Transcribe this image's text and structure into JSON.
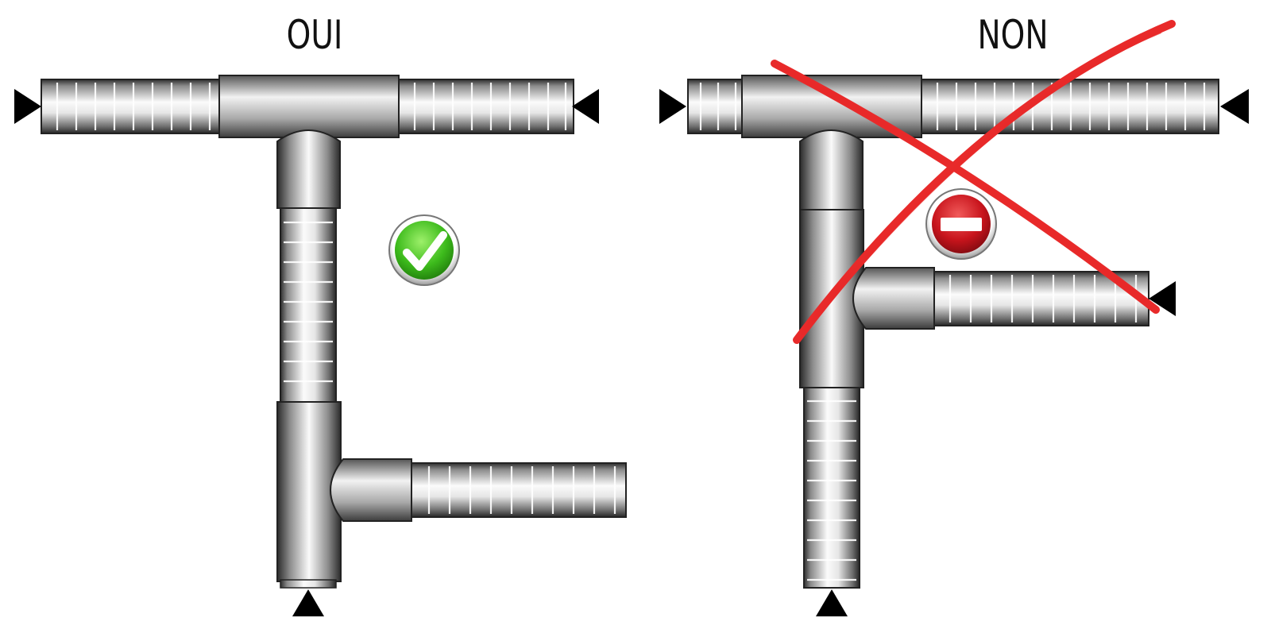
{
  "panels": {
    "left": {
      "title": "OUI",
      "status_icon": "check-icon",
      "status_color": "#3dbb1c"
    },
    "right": {
      "title": "NON",
      "status_icon": "no-entry-icon",
      "status_color": "#c8141c",
      "cross_color": "#e82a2a"
    }
  },
  "colors": {
    "arrow": "#000000",
    "pipe_light": "#f4f4f4",
    "pipe_dark": "#3a3a3a"
  }
}
